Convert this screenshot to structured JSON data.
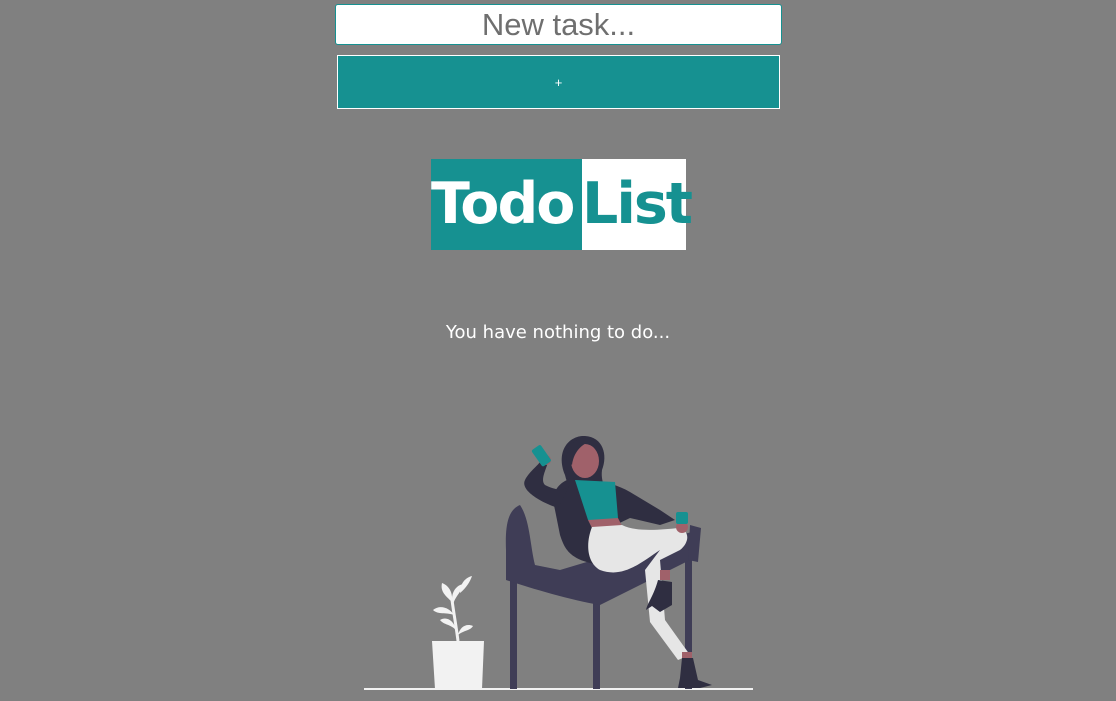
{
  "task_input": {
    "placeholder": "New task..."
  },
  "add_button": {
    "label": "+"
  },
  "logo": {
    "part1": "Todo",
    "part2": "List"
  },
  "empty_state": {
    "message": "You have nothing to do..."
  },
  "colors": {
    "accent": "#169191",
    "background": "#808080",
    "chair": "#3f3d56",
    "clothing_dark": "#2f2e41",
    "white": "#ffffff",
    "skin": "#a0616a",
    "plant": "#f2f2f2"
  },
  "illustration": {
    "icon": "woman-sitting-chair-illustration"
  }
}
